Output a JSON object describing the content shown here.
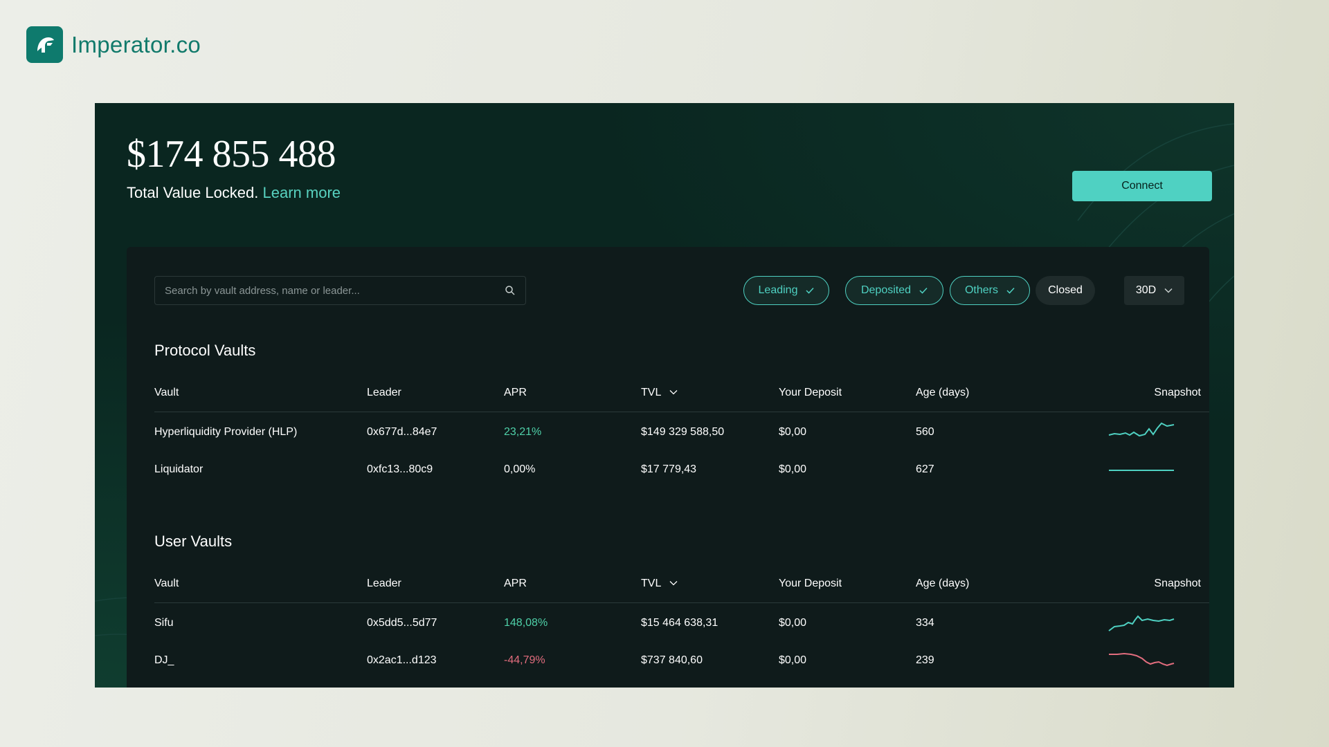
{
  "brand": {
    "name": "Imperator.co",
    "logo_icon": "spartan-helmet-icon",
    "color": "#117a6b"
  },
  "hero": {
    "tvl_value": "$174 855 488",
    "tvl_caption": "Total Value Locked.",
    "learn_more": "Learn more"
  },
  "connect_label": "Connect",
  "search": {
    "placeholder": "Search by vault address, name or leader...",
    "value": ""
  },
  "filters": [
    {
      "label": "Leading",
      "selected": true
    },
    {
      "label": "Deposited",
      "selected": true
    },
    {
      "label": "Others",
      "selected": true
    },
    {
      "label": "Closed",
      "selected": false
    }
  ],
  "period": "30D",
  "columns": {
    "vault": "Vault",
    "leader": "Leader",
    "apr": "APR",
    "tvl": "TVL",
    "deposit": "Your Deposit",
    "age": "Age (days)",
    "snapshot": "Snapshot"
  },
  "protocol_vaults": {
    "title": "Protocol Vaults",
    "rows": [
      {
        "vault": "Hyperliquidity Provider (HLP)",
        "leader": "0x677d...84e7",
        "apr": "23,21%",
        "apr_sign": "pos",
        "tvl": "$149 329 588,50",
        "deposit": "$0,00",
        "age": "560",
        "trend": "up"
      },
      {
        "vault": "Liquidator",
        "leader": "0xfc13...80c9",
        "apr": "0,00%",
        "apr_sign": "zero",
        "tvl": "$17 779,43",
        "deposit": "$0,00",
        "age": "627",
        "trend": "flat"
      }
    ]
  },
  "user_vaults": {
    "title": "User Vaults",
    "rows": [
      {
        "vault": "Sifu",
        "leader": "0x5dd5...5d77",
        "apr": "148,08%",
        "apr_sign": "pos",
        "tvl": "$15 464 638,31",
        "deposit": "$0,00",
        "age": "334",
        "trend": "up"
      },
      {
        "vault": "DJ_",
        "leader": "0x2ac1...d123",
        "apr": "-44,79%",
        "apr_sign": "neg",
        "tvl": "$737 840,60",
        "deposit": "$0,00",
        "age": "239",
        "trend": "down"
      }
    ]
  },
  "colors": {
    "accent": "#4fd1c2",
    "positive": "#4fd1a9",
    "negative": "#e26d7e",
    "panel": "#0a2620",
    "card": "#0f1b1b"
  }
}
